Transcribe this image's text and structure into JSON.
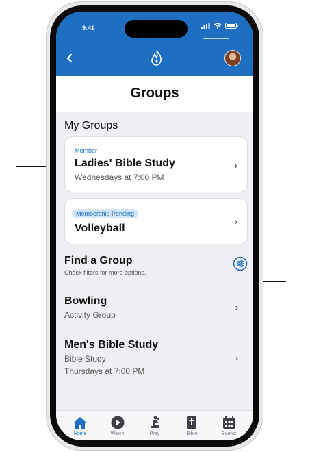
{
  "status_bar": {
    "time": "9:41"
  },
  "header": {
    "logo_icon": "flame-icon",
    "back_icon": "chevron-left-icon",
    "avatar": "user-avatar"
  },
  "page": {
    "title": "Groups"
  },
  "my_groups": {
    "heading": "My Groups",
    "items": [
      {
        "role": "Member",
        "name": "Ladies' Bible Study",
        "schedule": "Wednesdays at 7:00 PM"
      },
      {
        "role": "Membership Pending",
        "name": "Volleyball"
      }
    ]
  },
  "find_group": {
    "heading": "Find a Group",
    "hint": "Check filters for more options.",
    "filter_icon": "filter-icon",
    "items": [
      {
        "name": "Bowling",
        "type": "Activity Group"
      },
      {
        "name": "Men's Bible Study",
        "type": "Bible Study",
        "schedule": "Thursdays at 7:00 PM"
      }
    ]
  },
  "tabs": [
    {
      "label": "Home",
      "icon": "home-icon",
      "active": true
    },
    {
      "label": "Watch",
      "icon": "play-icon",
      "active": false
    },
    {
      "label": "Pray",
      "icon": "pray-icon",
      "active": false
    },
    {
      "label": "Bible",
      "icon": "bible-icon",
      "active": false
    },
    {
      "label": "Events",
      "icon": "calendar-icon",
      "active": false
    }
  ],
  "colors": {
    "brand": "#1e6fc2",
    "background": "#f0f0f4",
    "badge": "#d3e6f6"
  }
}
